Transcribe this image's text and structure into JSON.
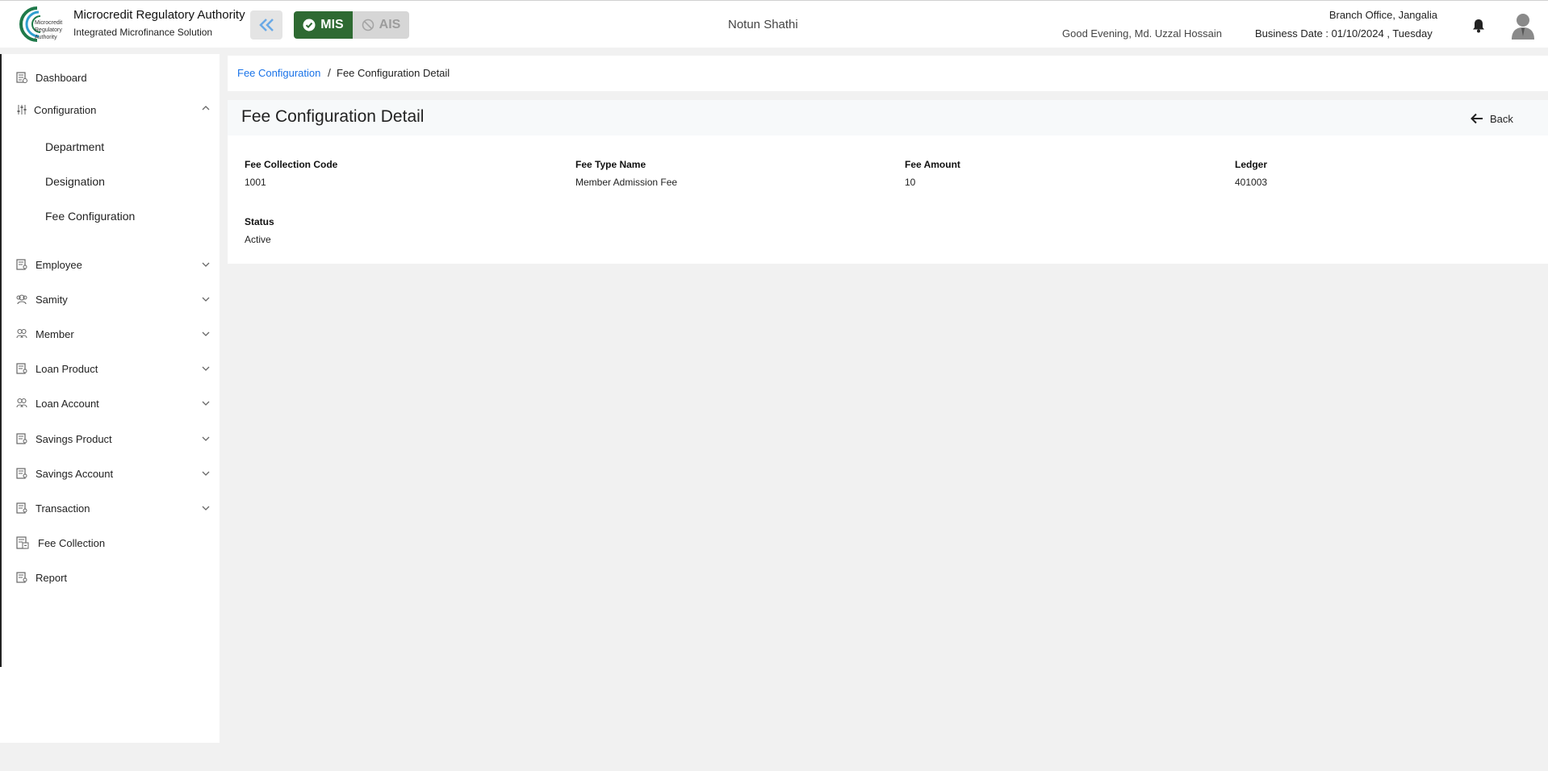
{
  "header": {
    "org_title": "Microcredit Regulatory Authority",
    "org_subtitle": "Integrated Microfinance Solution",
    "logo_text": "Microcredit Regulatory Authority",
    "mode_mis": "MIS",
    "mode_ais": "AIS",
    "organization": "Notun Shathi",
    "greeting": "Good Evening, Md. Uzzal Hossain",
    "branch": "Branch Office, Jangalia",
    "business_date": "Business Date : 01/10/2024 , Tuesday"
  },
  "sidebar": {
    "items": [
      {
        "label": "Dashboard",
        "icon": "dashboard-icon"
      },
      {
        "label": "Configuration",
        "icon": "sliders-icon",
        "expanded": true,
        "children": [
          "Department",
          "Designation",
          "Fee Configuration"
        ]
      },
      {
        "label": "Employee",
        "icon": "employee-icon"
      },
      {
        "label": "Samity",
        "icon": "samity-icon"
      },
      {
        "label": "Member",
        "icon": "member-icon"
      },
      {
        "label": "Loan Product",
        "icon": "loan-product-icon"
      },
      {
        "label": "Loan Account",
        "icon": "loan-account-icon"
      },
      {
        "label": "Savings Product",
        "icon": "savings-product-icon"
      },
      {
        "label": "Savings Account",
        "icon": "savings-account-icon"
      },
      {
        "label": "Transaction",
        "icon": "transaction-icon"
      },
      {
        "label": "Fee Collection",
        "icon": "fee-collection-icon"
      },
      {
        "label": "Report",
        "icon": "report-icon"
      }
    ]
  },
  "breadcrumb": {
    "link": "Fee Configuration",
    "separator": "/",
    "current": "Fee Configuration Detail"
  },
  "detail": {
    "title": "Fee Configuration Detail",
    "back_label": "Back",
    "fields": [
      {
        "label": "Fee Collection Code",
        "value": "1001"
      },
      {
        "label": "Fee Type Name",
        "value": "Member Admission Fee"
      },
      {
        "label": "Fee Amount",
        "value": "10"
      },
      {
        "label": "Ledger",
        "value": "401003"
      },
      {
        "label": "Status",
        "value": "Active"
      }
    ]
  },
  "colors": {
    "mis_active": "#2e6a32",
    "link": "#1a73e8"
  }
}
